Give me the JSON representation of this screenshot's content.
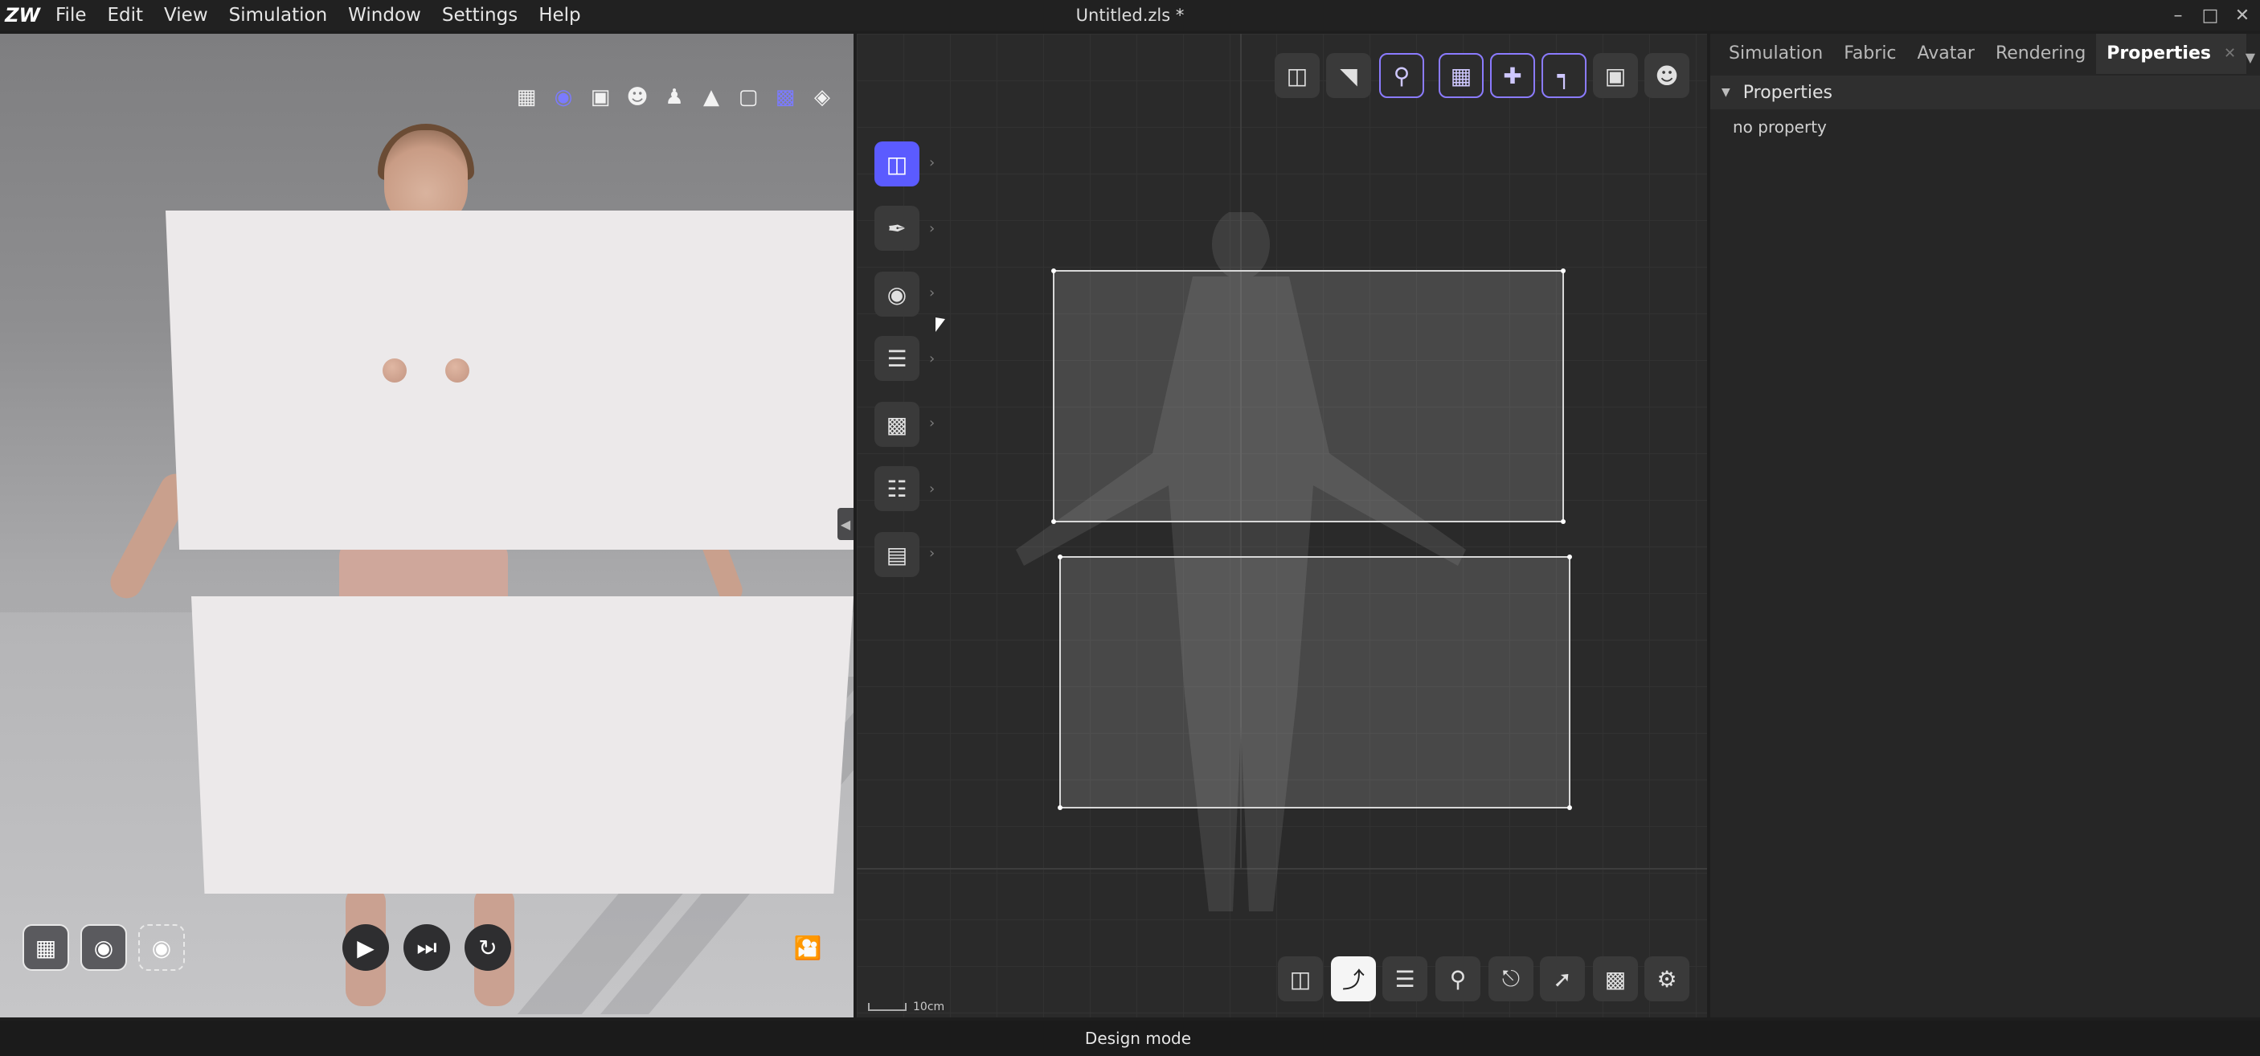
{
  "app": {
    "logo": "ZW",
    "title": "Untitled.zls *",
    "menu": [
      "File",
      "Edit",
      "View",
      "Simulation",
      "Window",
      "Settings",
      "Help"
    ]
  },
  "window_controls": {
    "minimize_icon": "minimize-icon",
    "maximize_icon": "maximize-icon",
    "close_icon": "close-icon"
  },
  "viewport3d": {
    "top_icons": [
      "mesh-icon",
      "texture-sphere-icon",
      "fabric-layer-icon",
      "avatar-icon",
      "pose-icon",
      "garment-icon",
      "box-icon",
      "camera-rig-icon",
      "cube-icon"
    ],
    "bottom_left_buttons": [
      "render-icon",
      "render-view-icon",
      "snapshot-icon"
    ],
    "bottom_center_buttons": [
      "play-icon",
      "step-forward-icon",
      "reset-icon"
    ],
    "bottom_right_button": "video-icon"
  },
  "viewport2d": {
    "left_tools": [
      "select-pattern-icon",
      "pen-icon",
      "internal-shape-icon",
      "sewing-icon",
      "texture-icon",
      "fold-icon",
      "measure-icon"
    ],
    "top_tools": [
      "pattern-view-icon",
      "edit-pattern-icon",
      "pin-icon",
      "grid-view-icon",
      "symmetry-icon",
      "seam-view-icon",
      "arrange-icon",
      "avatar-view-icon"
    ],
    "bottom_tools": [
      "transform-icon",
      "curve-point-icon",
      "sewing-line-icon",
      "pin-tool-icon",
      "lock-icon",
      "segment-icon",
      "image-icon",
      "settings-icon"
    ],
    "scale_label": "10cm"
  },
  "right_panel": {
    "tabs": [
      "Simulation",
      "Fabric",
      "Avatar",
      "Rendering",
      "Properties"
    ],
    "active_tab": "Properties",
    "section_title": "Properties",
    "empty_text": "no property"
  },
  "status": {
    "mode": "Design mode"
  },
  "colors": {
    "accent": "#5b5bff",
    "accent_outline": "#8b7bff",
    "panel": "#262626",
    "grid": "#2a2a2a"
  }
}
